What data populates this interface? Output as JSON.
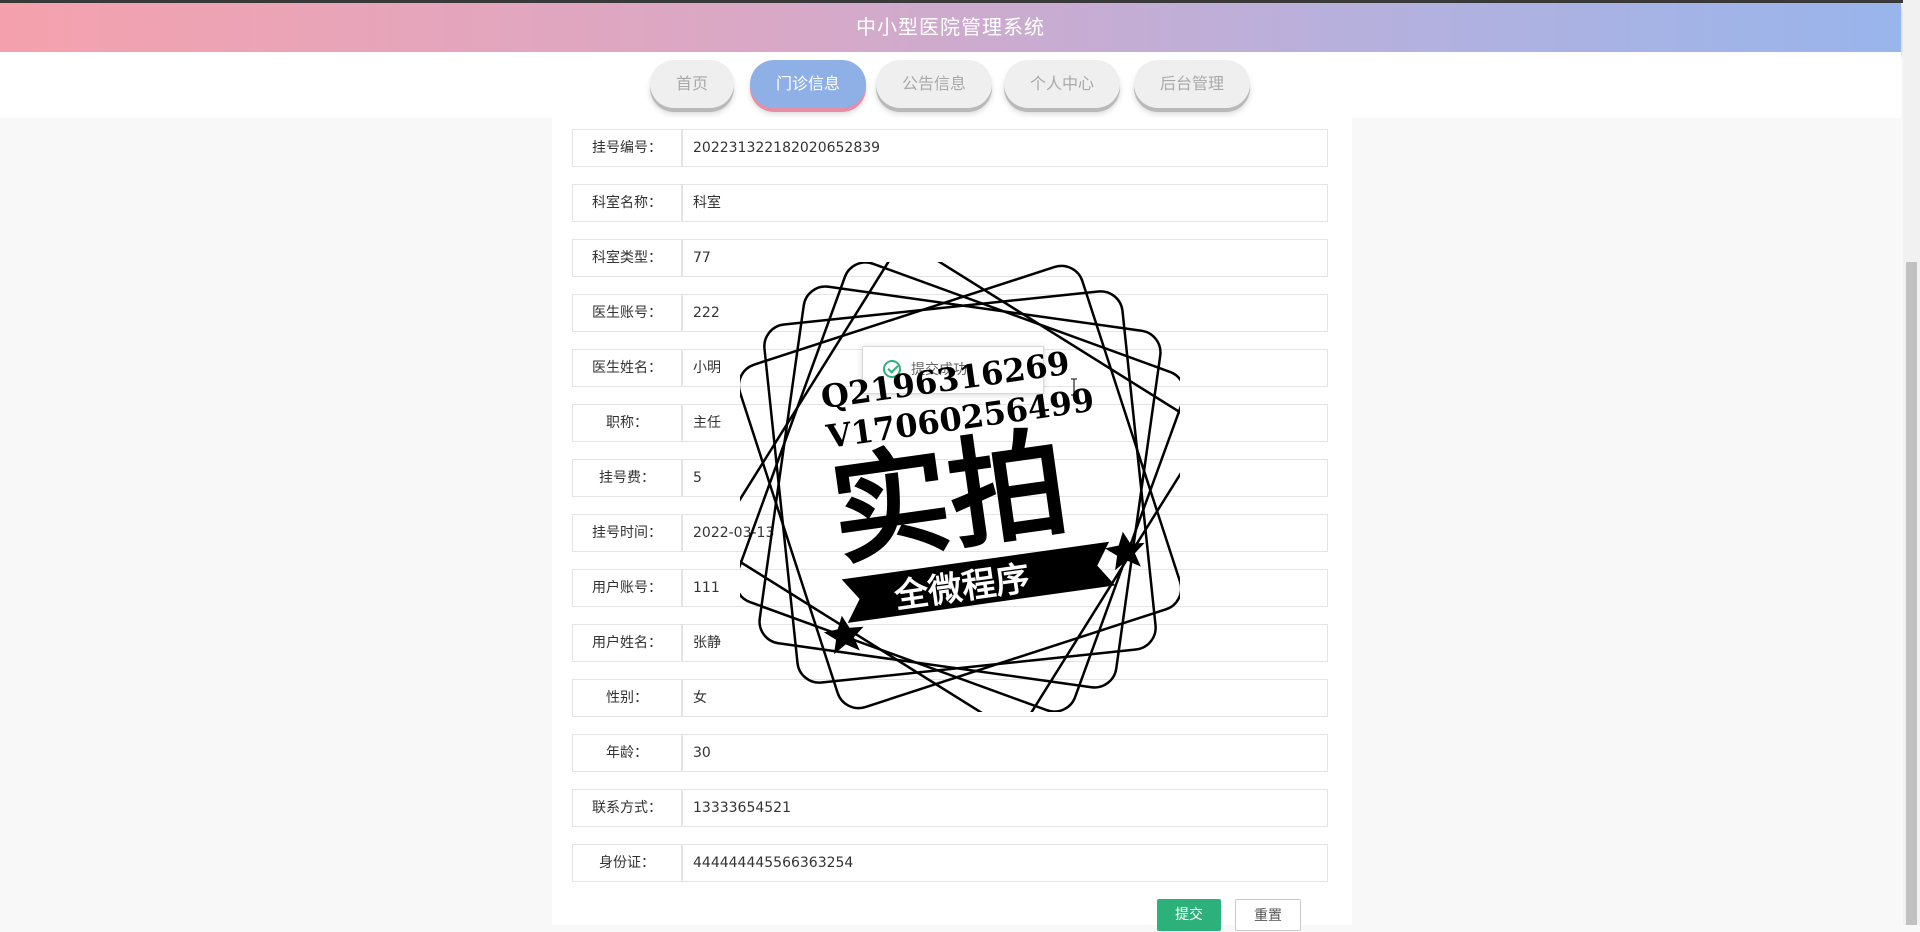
{
  "header": {
    "title": "中小型医院管理系统"
  },
  "nav": {
    "items": [
      "首页",
      "门诊信息",
      "公告信息",
      "个人中心",
      "后台管理"
    ],
    "active_index": 1
  },
  "form": {
    "rows": [
      {
        "label": "挂号编号：",
        "value": "2022313221820206528​39"
      },
      {
        "label": "科室名称：",
        "value": "科室"
      },
      {
        "label": "科室类型：",
        "value": "77"
      },
      {
        "label": "医生账号：",
        "value": "222"
      },
      {
        "label": "医生姓名：",
        "value": "小明"
      },
      {
        "label": "职称：",
        "value": "主任"
      },
      {
        "label": "挂号费：",
        "value": "5"
      },
      {
        "label": "挂号时间：",
        "value": "2022-03-13"
      },
      {
        "label": "用户账号：",
        "value": "111"
      },
      {
        "label": "用户姓名：",
        "value": "张静"
      },
      {
        "label": "性别：",
        "value": "女"
      },
      {
        "label": "年龄：",
        "value": "30"
      },
      {
        "label": "联系方式：",
        "value": "13333654521"
      },
      {
        "label": "身份证：",
        "value": "444444445566363254"
      }
    ],
    "submit_label": "提交",
    "reset_label": "重置"
  },
  "toast": {
    "message": "提交成功"
  },
  "watermark": {
    "line1": "Q2196316269",
    "line2": "V17060256499",
    "main_text": "实拍",
    "banner_text": "全微程序"
  },
  "colors": {
    "header_gradient_start": "#f5a1ad",
    "header_gradient_end": "#98b5ec",
    "active_tab": "#8fb0e6",
    "submit_button": "#2db17b"
  }
}
